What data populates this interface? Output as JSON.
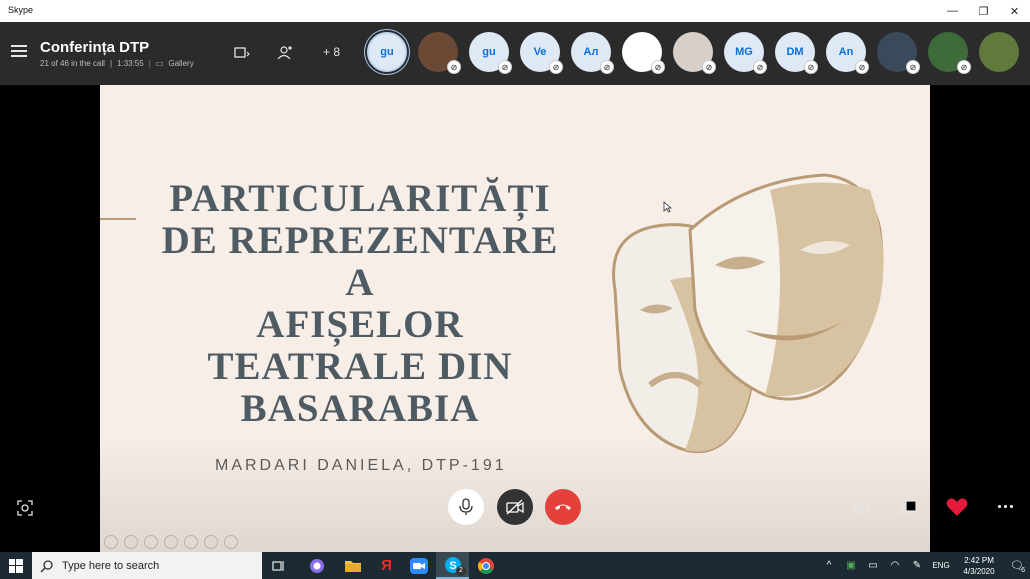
{
  "window": {
    "title": "Skype",
    "minimize": "—",
    "restore": "❐",
    "close": "✕"
  },
  "call": {
    "title": "Conferința DTP",
    "participants_info": "21 of 46 in the call",
    "duration": "1:33:55",
    "view_mode": "Gallery",
    "extra_participants": "+ 8"
  },
  "participants": [
    {
      "initials": "gu",
      "active": true
    },
    {
      "initials": "",
      "photo": true,
      "color": "#6b4a35"
    },
    {
      "initials": "gu"
    },
    {
      "initials": "Ve"
    },
    {
      "initials": "Ал"
    },
    {
      "initials": "",
      "blank": true
    },
    {
      "initials": "",
      "photo": true,
      "color": "#d8d0c8"
    },
    {
      "initials": "MG"
    },
    {
      "initials": "DM"
    },
    {
      "initials": "An"
    },
    {
      "initials": "",
      "photo": true,
      "color": "#3a4a5a"
    },
    {
      "initials": "",
      "photo": true,
      "color": "#3f6a3a"
    },
    {
      "initials": "",
      "photo": true,
      "color": "#5f7a3a"
    }
  ],
  "slide": {
    "title_lines": [
      "PARTICULARITĂȚI",
      "DE REPREZENTARE",
      "A",
      "AFIȘELOR",
      "TEATRALE DIN",
      "BASARABIA"
    ],
    "author": "MARDARI DANIELA, DTP-191"
  },
  "taskbar": {
    "search_placeholder": "Type here to search",
    "skype_badge": "2",
    "language": "ENG",
    "time": "2:42 PM",
    "date": "4/3/2020",
    "notification_count": "6"
  },
  "colors": {
    "end_call": "#e3413a",
    "heart": "#e21b3c",
    "accent_blue": "#0a6fd6"
  }
}
